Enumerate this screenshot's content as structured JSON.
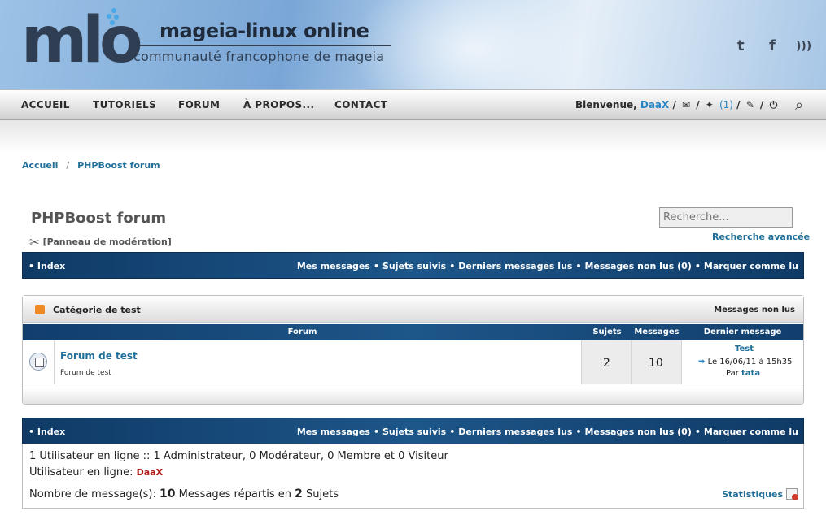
{
  "header": {
    "logo_text": "mlo",
    "site_title": "mageia-linux online",
    "site_subtitle": "communauté francophone de mageia",
    "social_icons": [
      "twitter-icon",
      "facebook-icon",
      "rss-icon"
    ]
  },
  "nav": {
    "items": [
      "ACCUEIL",
      "TUTORIELS",
      "FORUM",
      "À PROPOS...",
      "CONTACT"
    ],
    "welcome": "Bienvenue,",
    "username": "DaaX",
    "admin_count": "(1)"
  },
  "breadcrumb": [
    "Accueil",
    "PHPBoost forum"
  ],
  "page": {
    "title": "PHPBoost forum",
    "mod_panel": "[Panneau de modération]",
    "search_placeholder": "Recherche...",
    "advanced_search": "Recherche avancée"
  },
  "toolbar": {
    "index": "Index",
    "links": [
      "Mes messages",
      "Sujets suivis",
      "Derniers messages lus",
      "Messages non lus (0)",
      "Marquer comme lu"
    ]
  },
  "category": {
    "title": "Catégorie de test",
    "unread": "Messages non lus",
    "columns": [
      "Forum",
      "Sujets",
      "Messages",
      "Dernier message"
    ],
    "forums": [
      {
        "name": "Forum de test",
        "description": "Forum de test",
        "topics": "2",
        "messages": "10",
        "last_title": "Test",
        "last_date": "Le 16/06/11 à 15h35",
        "last_by_prefix": "Par",
        "last_by_user": "tata"
      }
    ]
  },
  "stats": {
    "online_line": "1 Utilisateur en ligne :: 1 Administrateur, 0 Modérateur, 0 Membre et 0 Visiteur",
    "online_users_label": "Utilisateur en ligne:",
    "online_user": "DaaX",
    "messages_prefix": "Nombre de message(s):",
    "messages_count": "10",
    "messages_mid": "Messages répartis en",
    "topics_count": "2",
    "topics_suffix": "Sujets",
    "statistics_link": "Statistiques"
  }
}
